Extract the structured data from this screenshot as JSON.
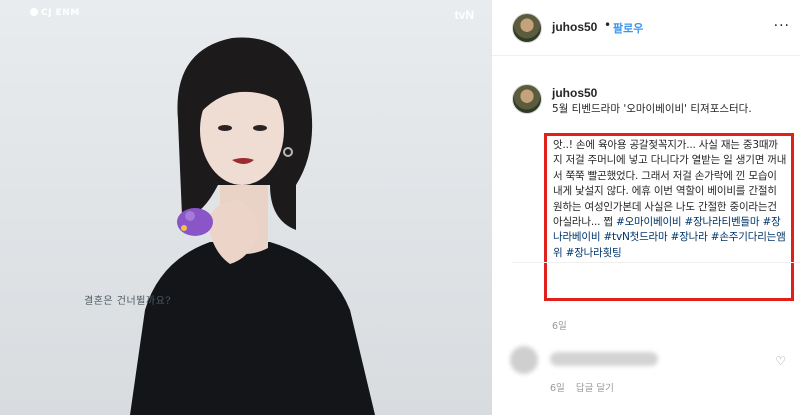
{
  "poster": {
    "brand_left": "CJ ENM",
    "brand_right": "tvN",
    "tagline": "결혼은 건너뛸까요?"
  },
  "header": {
    "username": "juhos50",
    "separator": "•",
    "follow_label": "팔로우",
    "more_label": "···"
  },
  "post": {
    "username": "juhos50",
    "caption_lead": "5월 티벤드라마 '오마이베이비' 티져포스터다.",
    "caption_body": "앗..! 손에 육아용 공갈젖꼭지가... 사실 재는 중3때까지 저걸 주머니에 넣고 다니다가 열받는 일 생기면 꺼내서 쭉쭉 빨곤했었다. 그래서 저걸 손가락에 낀 모습이 내게 낯설지 않다. 에휴 이번 역할이 베이비를 간절히 원하는 여성인가본데 사실은 나도 간절한 중이라는건 아실라나... 쩝",
    "hashtags": [
      "#오마이베이비",
      "#장나라티벤들마",
      "#장나라베이비",
      "#tvN첫드라마",
      "#장나라",
      "#손주기다리는앰위",
      "#장나라횟팅"
    ],
    "time": "6일"
  },
  "comment": {
    "time": "6일",
    "reply_label": "답글 달기",
    "like_icon": "♡"
  },
  "colors": {
    "highlight_border": "#e0211b",
    "link_blue": "#3897f0",
    "hashtag": "#003569"
  }
}
